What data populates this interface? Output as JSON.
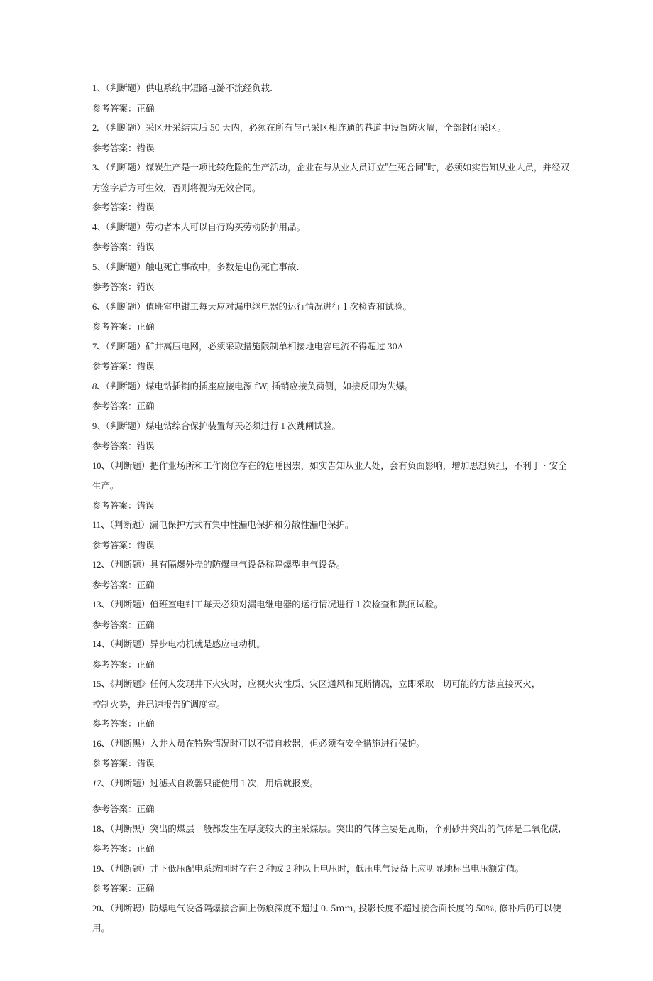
{
  "answer_prefix": "参考答案：",
  "judge_label": "（判断题）",
  "judge_label_alt_black": "（判断黑）",
  "judge_label_alt_ti": "《判断题》",
  "judge_label_alt_bie": "（判断甥）",
  "items": [
    {
      "num": "1、",
      "label": "judge_label",
      "text": "供电系统中短路电潞不流经负载.",
      "answer": "正确"
    },
    {
      "num": "2, ",
      "label": "judge_label",
      "text": "采区开采结束后 50 天内，必须在所有与己采区相连通的巷道中设置防火墙，全部封闭采区。",
      "answer": "错误"
    },
    {
      "num": "3、",
      "label": "judge_label",
      "text": "煤炭生产是一项比较危险的生产活动，企业在与从业人员订立\"生死合同\"时，必须如实告知从业人员，并经双方签字后方可生效，否则将视为无效合同。",
      "answer": "错误"
    },
    {
      "num": "4、",
      "label": "judge_label",
      "text": "劳动者本人可以自行购买劳动防护用品。",
      "answer": "错误"
    },
    {
      "num": "5、",
      "label": "judge_label",
      "text": "触电死亡事故中，多数是电伤死亡事故.",
      "answer": "错误"
    },
    {
      "num": "6、",
      "label": "judge_label",
      "text": "值班室电钳工每天应对漏电继电器的运行情况进行 1 次检查和试验。",
      "answer": "正确"
    },
    {
      "num": "7、",
      "label": "judge_label",
      "text": "矿井高压电网，必须采取措施限制单相接地电容电流不得超过 30A.",
      "answer": "错误"
    },
    {
      "num": "8",
      "num_italic": true,
      "num_suffix": "、",
      "label": "judge_label",
      "text": "煤电钻插销的插座应接电源 fW, 插销应接负荷侧，如接反即为失爆。",
      "answer": "正确"
    },
    {
      "num": "9、",
      "label": "judge_label",
      "text": "煤电钻综合保护装置每天必须进行 1 次跳闸试验。",
      "answer": "错误"
    },
    {
      "num": "10、",
      "label": "judge_label",
      "text": "把作业场所和工作岗位存在的危唾因崇，如实告知从业人处，会有负面影响，增加思想负担，不利丁•安全生产。",
      "answer": "错误"
    },
    {
      "num": "11、",
      "label": "judge_label",
      "text": "漏电保护方式有集中性漏电保护和分散性漏电保护。",
      "answer": "错误"
    },
    {
      "num": "12、",
      "label": "judge_label",
      "text": "具有隔爆外壳的防爆电气设备称隔爆型电气设备。",
      "answer": "正确"
    },
    {
      "num": "13、",
      "label": "judge_label",
      "text": "值班室电钳工每天必须对漏电继电器的运行情况进行 1 次检查和跳闸试验。",
      "answer": "正确"
    },
    {
      "num": "14、",
      "label": "judge_label",
      "text": "异步电动机就是感应电动机。",
      "answer": "正确"
    },
    {
      "num": "15、",
      "label": "judge_label_alt_ti",
      "text": "任何人发现井下火灾时，应视火灾性质、灾区通风和瓦斯情况，立即采取一切可能的方法直接灭火，",
      "text2": "控制火势，并迅速报告矿调度室。",
      "answer": "正确"
    },
    {
      "num": "16、",
      "label": "judge_label_alt_black",
      "text": "入井人员在特殊情况时可以不带自救器，但必须有安全措施进行保护。",
      "answer": "错误"
    },
    {
      "num": "17",
      "num_italic": true,
      "num_suffix": "、",
      "label": "judge_label",
      "text": "过滤式自救器只能使用 1 次，用后就报废。",
      "answer": "正确",
      "extra_gap": true
    },
    {
      "num": "18、",
      "label": "judge_label_alt_black",
      "text": "突出的煤层一般都发生在厚度较大的主采煤层。突出的气体主要是瓦斯，个别砂井突出的气体是二氧化碳,",
      "answer": "正确"
    },
    {
      "num": "19、",
      "label": "judge_label",
      "text": "井下低压配电系统同时存在 2 种或 2 种以上电压时，低压电气设备上应明显地标出电压额定值。",
      "answer": "正确"
    },
    {
      "num": "20、",
      "label": "judge_label_alt_bie",
      "text": "防爆电气设备隔爆接合面上伤痕深度不超过 0. 5mm, 投影长度不超过接合面长度的 50%, 修补后仍可以使用。"
    }
  ]
}
